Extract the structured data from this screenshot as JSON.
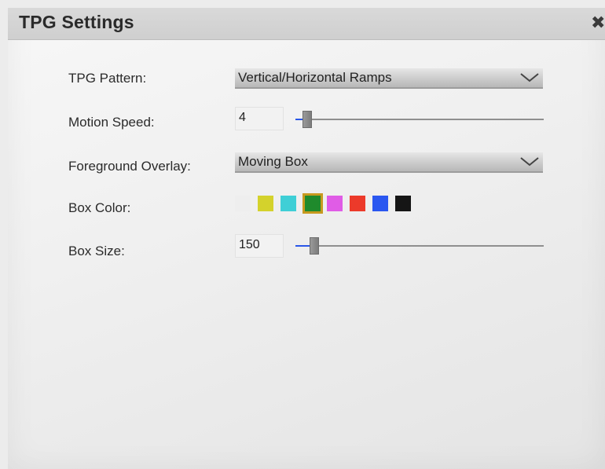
{
  "dialog": {
    "title": "TPG Settings",
    "close_icon": "close-icon"
  },
  "fields": {
    "tpg_pattern": {
      "label": "TPG Pattern:",
      "value": "Vertical/Horizontal Ramps"
    },
    "motion_speed": {
      "label": "Motion Speed:",
      "value": "4",
      "slider_level": 0.03
    },
    "foreground_overlay": {
      "label": "Foreground Overlay:",
      "value": "Moving Box"
    },
    "box_color": {
      "label": "Box Color:",
      "swatches": [
        "#eeeeee",
        "#d4d22c",
        "#3fcfd6",
        "#1f8a2c",
        "#e05ce6",
        "#ec3a2a",
        "#2a57f0",
        "#151515"
      ],
      "selected_index": 3,
      "selected_color": "#c79a1f"
    },
    "box_size": {
      "label": "Box Size:",
      "value": "150",
      "slider_level": 0.06
    }
  },
  "colors": {
    "slider_fill": "#2a57e8",
    "title_bar": "#d3d3d3"
  }
}
